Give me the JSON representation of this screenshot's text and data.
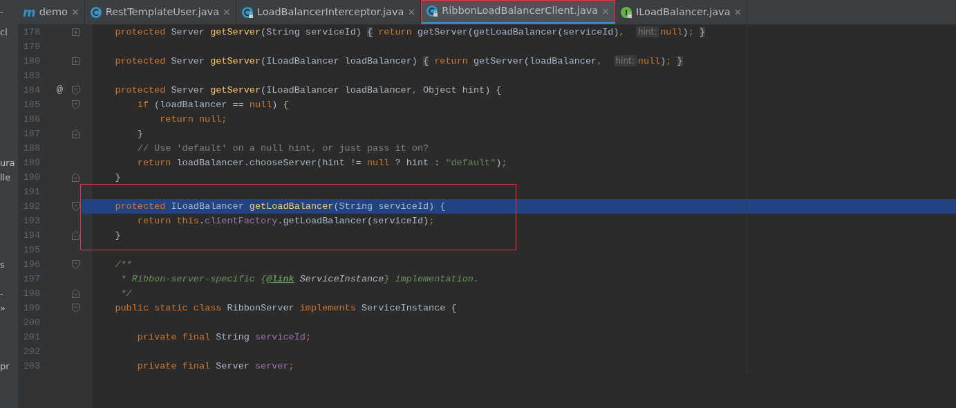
{
  "side_panel": {
    "top_fragment": "-"
  },
  "tabs": [
    {
      "label": "demo",
      "kind": "module",
      "icon_glyph": "m",
      "selected": false,
      "boxed": false,
      "close": "×"
    },
    {
      "label": "RestTemplateUser.java",
      "kind": "class",
      "locked": false,
      "selected": false,
      "boxed": false,
      "close": "×"
    },
    {
      "label": "LoadBalancerInterceptor.java",
      "kind": "class",
      "locked": true,
      "selected": false,
      "boxed": false,
      "close": "×"
    },
    {
      "label": "RibbonLoadBalancerClient.java",
      "kind": "class",
      "locked": true,
      "selected": true,
      "boxed": true,
      "close": "×"
    },
    {
      "label": "ILoadBalancer.java",
      "kind": "interface",
      "locked": true,
      "selected": false,
      "boxed": false,
      "close": "×"
    }
  ],
  "editor": {
    "lines": [
      {
        "number": "178",
        "side": "cl",
        "fold_marker": {
          "kind": "collapsed"
        },
        "selected": false,
        "boxed": false,
        "tokens": [
          {
            "kind": "keyword",
            "text": "    protected"
          },
          {
            "kind": "plain",
            "text": " Server "
          },
          {
            "kind": "method",
            "text": "getServer"
          },
          {
            "kind": "plain",
            "text": "(String serviceId) "
          },
          {
            "kind": "folded",
            "text": "{"
          },
          {
            "kind": "keyword",
            "text": " return"
          },
          {
            "kind": "plain",
            "text": " getServer(getLoadBalancer(serviceId)"
          },
          {
            "kind": "keyword",
            "text": ",  "
          },
          {
            "kind": "hint",
            "text": "hint:"
          },
          {
            "kind": "keyword",
            "text": "null"
          },
          {
            "kind": "plain",
            "text": ")"
          },
          {
            "kind": "keyword",
            "text": "; "
          },
          {
            "kind": "folded",
            "text": "}"
          }
        ]
      },
      {
        "number": "179",
        "selected": false,
        "boxed": false
      },
      {
        "number": "180",
        "fold_marker": {
          "kind": "collapsed"
        },
        "selected": false,
        "boxed": false,
        "tokens": [
          {
            "kind": "keyword",
            "text": "    protected"
          },
          {
            "kind": "plain",
            "text": " Server "
          },
          {
            "kind": "method",
            "text": "getServer"
          },
          {
            "kind": "plain",
            "text": "(ILoadBalancer loadBalancer) "
          },
          {
            "kind": "folded",
            "text": "{"
          },
          {
            "kind": "keyword",
            "text": " return"
          },
          {
            "kind": "plain",
            "text": " getServer(loadBalancer"
          },
          {
            "kind": "keyword",
            "text": ",  "
          },
          {
            "kind": "hint",
            "text": "hint:"
          },
          {
            "kind": "keyword",
            "text": "null"
          },
          {
            "kind": "plain",
            "text": ")"
          },
          {
            "kind": "keyword",
            "text": "; "
          },
          {
            "kind": "folded",
            "text": "}"
          }
        ]
      },
      {
        "number": "183",
        "selected": false,
        "boxed": false
      },
      {
        "number": "184",
        "annotation": "@",
        "fold_marker": {
          "kind": "start"
        },
        "selected": false,
        "boxed": false,
        "tokens": [
          {
            "kind": "keyword",
            "text": "    protected"
          },
          {
            "kind": "plain",
            "text": " Server "
          },
          {
            "kind": "method",
            "text": "getServer"
          },
          {
            "kind": "plain",
            "text": "(ILoadBalancer loadBalancer"
          },
          {
            "kind": "keyword",
            "text": ","
          },
          {
            "kind": "plain",
            "text": " Object hint) {"
          }
        ]
      },
      {
        "number": "185",
        "fold_marker": {
          "kind": "start"
        },
        "selected": false,
        "boxed": false,
        "tokens": [
          {
            "kind": "keyword",
            "text": "        if"
          },
          {
            "kind": "plain",
            "text": " (loadBalancer == "
          },
          {
            "kind": "keyword",
            "text": "null"
          },
          {
            "kind": "plain",
            "text": ") {"
          }
        ]
      },
      {
        "number": "186",
        "selected": false,
        "boxed": false,
        "tokens": [
          {
            "kind": "keyword",
            "text": "            return null;"
          }
        ]
      },
      {
        "number": "187",
        "fold_marker": {
          "kind": "end"
        },
        "selected": false,
        "boxed": false,
        "tokens": [
          {
            "kind": "plain",
            "text": "        }"
          }
        ]
      },
      {
        "number": "188",
        "selected": false,
        "boxed": false,
        "tokens": [
          {
            "kind": "comment",
            "text": "        // Use 'default' on a null hint, or just pass it on?"
          }
        ]
      },
      {
        "number": "189",
        "side": "ura",
        "selected": false,
        "boxed": false,
        "tokens": [
          {
            "kind": "keyword",
            "text": "        return"
          },
          {
            "kind": "plain",
            "text": " loadBalancer.chooseServer(hint != "
          },
          {
            "kind": "keyword",
            "text": "null"
          },
          {
            "kind": "plain",
            "text": " ? hint : "
          },
          {
            "kind": "string",
            "text": "\"default\""
          },
          {
            "kind": "plain",
            "text": ")"
          },
          {
            "kind": "keyword",
            "text": ";"
          }
        ]
      },
      {
        "number": "190",
        "side": "lle",
        "fold_marker": {
          "kind": "end"
        },
        "selected": false,
        "boxed": false,
        "tokens": [
          {
            "kind": "plain",
            "text": "    }"
          }
        ]
      },
      {
        "number": "191",
        "selected": false,
        "boxed": true
      },
      {
        "number": "192",
        "fold_marker": {
          "kind": "start"
        },
        "selected": true,
        "boxed": true,
        "tokens": [
          {
            "kind": "keyword",
            "text": "    protected"
          },
          {
            "kind": "plain",
            "text": " ILoadBalancer "
          },
          {
            "kind": "method",
            "text": "getLoadBalancer"
          },
          {
            "kind": "plain",
            "text": "(String serviceId) {"
          }
        ]
      },
      {
        "number": "193",
        "selected": false,
        "boxed": true,
        "tokens": [
          {
            "kind": "keyword",
            "text": "        return this"
          },
          {
            "kind": "plain",
            "text": "."
          },
          {
            "kind": "field",
            "text": "clientFactory"
          },
          {
            "kind": "plain",
            "text": ".getLoadBalancer(serviceId)"
          },
          {
            "kind": "keyword",
            "text": ";"
          }
        ]
      },
      {
        "number": "194",
        "fold_marker": {
          "kind": "end"
        },
        "selected": false,
        "boxed": true,
        "tokens": [
          {
            "kind": "plain",
            "text": "    }"
          }
        ]
      },
      {
        "number": "195",
        "selected": false,
        "boxed": false
      },
      {
        "number": "196",
        "side": "s",
        "fold_marker": {
          "kind": "start"
        },
        "selected": false,
        "boxed": false,
        "tokens": [
          {
            "kind": "doc",
            "text": "    /**"
          }
        ]
      },
      {
        "number": "197",
        "selected": false,
        "boxed": false,
        "tokens": [
          {
            "kind": "doc",
            "text": "     * Ribbon-server-specific {"
          },
          {
            "kind": "doctag",
            "text": "@link"
          },
          {
            "kind": "docref",
            "text": " ServiceInstance"
          },
          {
            "kind": "doc",
            "text": "} implementation."
          }
        ]
      },
      {
        "number": "198",
        "side": "-",
        "fold_marker": {
          "kind": "end"
        },
        "selected": false,
        "boxed": false,
        "tokens": [
          {
            "kind": "doc",
            "text": "     */"
          }
        ]
      },
      {
        "number": "199",
        "side": "»",
        "fold_marker": {
          "kind": "start"
        },
        "selected": false,
        "boxed": false,
        "tokens": [
          {
            "kind": "keyword",
            "text": "    public static class"
          },
          {
            "kind": "plain",
            "text": " RibbonServer "
          },
          {
            "kind": "keyword",
            "text": "implements"
          },
          {
            "kind": "plain",
            "text": " ServiceInstance {"
          }
        ]
      },
      {
        "number": "200",
        "selected": false,
        "boxed": false
      },
      {
        "number": "201",
        "selected": false,
        "boxed": false,
        "tokens": [
          {
            "kind": "keyword",
            "text": "        private final"
          },
          {
            "kind": "plain",
            "text": " String "
          },
          {
            "kind": "field",
            "text": "serviceId"
          },
          {
            "kind": "keyword",
            "text": ";"
          }
        ]
      },
      {
        "number": "202",
        "selected": false,
        "boxed": false
      },
      {
        "number": "203",
        "side": "pr",
        "selected": false,
        "boxed": false,
        "tokens": [
          {
            "kind": "keyword",
            "text": "        private final"
          },
          {
            "kind": "plain",
            "text": " Server "
          },
          {
            "kind": "field",
            "text": "server"
          },
          {
            "kind": "keyword",
            "text": ";"
          }
        ]
      }
    ]
  }
}
